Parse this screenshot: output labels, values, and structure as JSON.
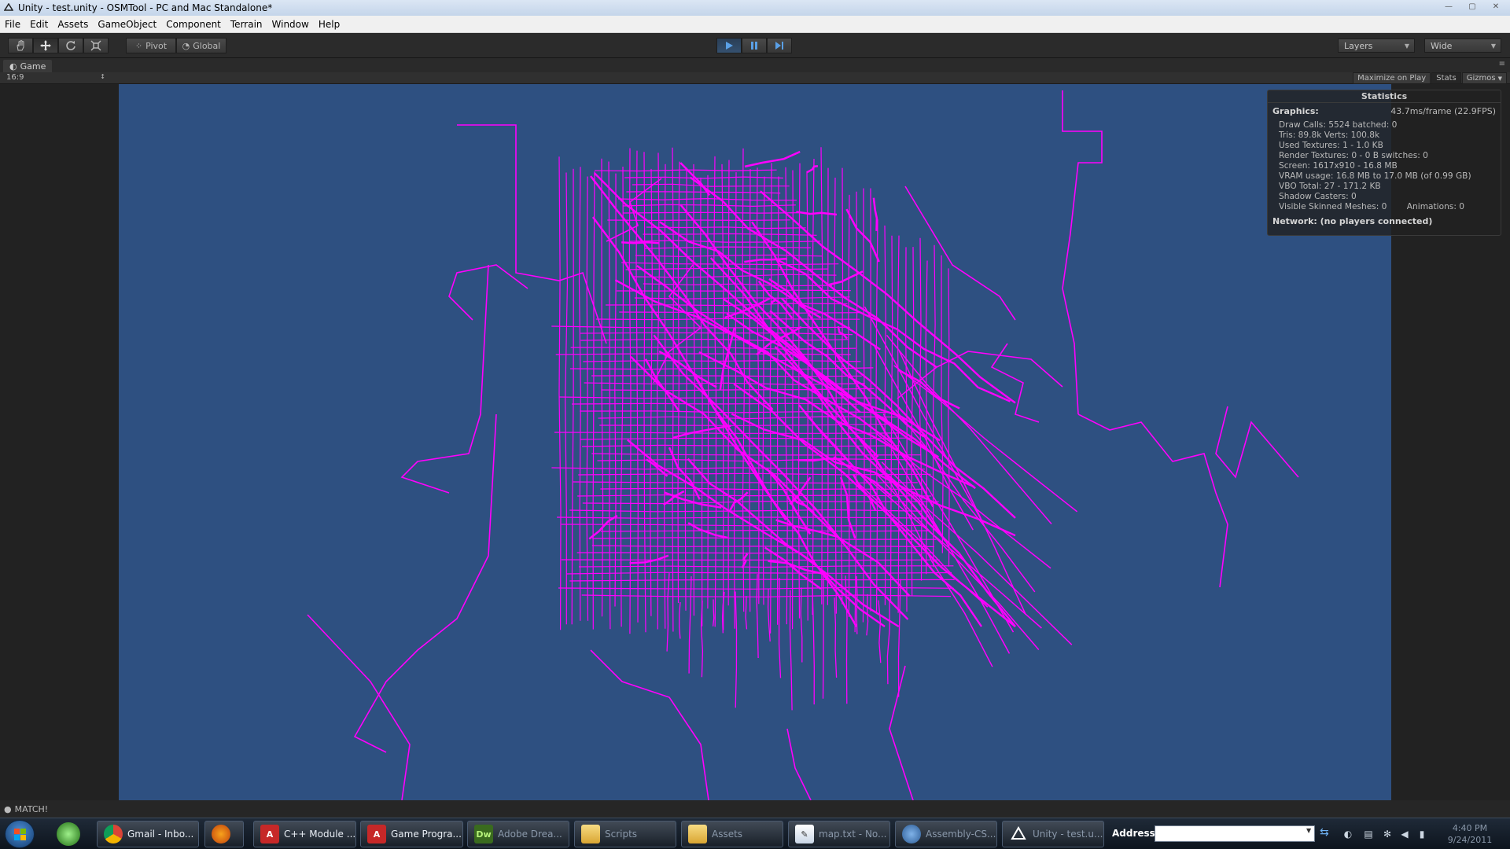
{
  "window": {
    "title": "Unity - test.unity - OSMTool - PC and Mac Standalone*",
    "min": "—",
    "max": "▢",
    "close": "✕"
  },
  "menu": [
    "File",
    "Edit",
    "Assets",
    "GameObject",
    "Component",
    "Terrain",
    "Window",
    "Help"
  ],
  "toolbar": {
    "pivot": "Pivot",
    "global": "Global",
    "layers": "Layers",
    "layout": "Wide"
  },
  "game": {
    "tab": "Game",
    "aspect": "16:9",
    "maximize": "Maximize on Play",
    "stats": "Stats",
    "gizmos": "Gizmos"
  },
  "stats": {
    "title": "Statistics",
    "graphics_label": "Graphics:",
    "frame": "43.7ms/frame (22.9FPS)",
    "lines": [
      "Draw Calls: 5524 batched: 0",
      "Tris: 89.8k   Verts: 100.8k",
      "Used Textures: 1 - 1.0 KB",
      "Render Textures: 0 - 0 B  switches: 0",
      "Screen: 1617x910 - 16.8 MB",
      "VRAM usage: 16.8 MB to 17.0 MB (of 0.99 GB)",
      "VBO Total: 27 - 171.2 KB",
      "Shadow Casters: 0"
    ],
    "skinned": "Visible Skinned Meshes: 0",
    "animations": "Animations: 0",
    "network": "Network: (no players connected)"
  },
  "status": {
    "message": "MATCH!"
  },
  "colors": {
    "viewport_bg": "#2e5081",
    "roads": "#ff00ff",
    "accent": "#5aa0e6"
  },
  "taskbar": {
    "tasks": [
      {
        "label": "Gmail - Inbo...",
        "icon": "chrome-icon",
        "active": true
      },
      {
        "label": "",
        "icon": "firefox-icon",
        "active": true
      },
      {
        "label": "C++ Module ...",
        "icon": "pdf-icon",
        "active": true
      },
      {
        "label": "Game Progra...",
        "icon": "pdf-icon",
        "active": true
      },
      {
        "label": "Adobe Drea...",
        "icon": "dreamweaver-icon",
        "active": false
      },
      {
        "label": "Scripts",
        "icon": "folder-icon",
        "active": false
      },
      {
        "label": "Assets",
        "icon": "folder-icon",
        "active": false
      },
      {
        "label": "map.txt - No...",
        "icon": "notepad-icon",
        "active": false
      },
      {
        "label": "Assembly-CS...",
        "icon": "monodevelop-icon",
        "active": false
      },
      {
        "label": "Unity - test.u...",
        "icon": "unity-icon",
        "active": false
      }
    ],
    "address_label": "Address",
    "clock_time": "4:40 PM",
    "clock_date": "9/24/2011"
  }
}
